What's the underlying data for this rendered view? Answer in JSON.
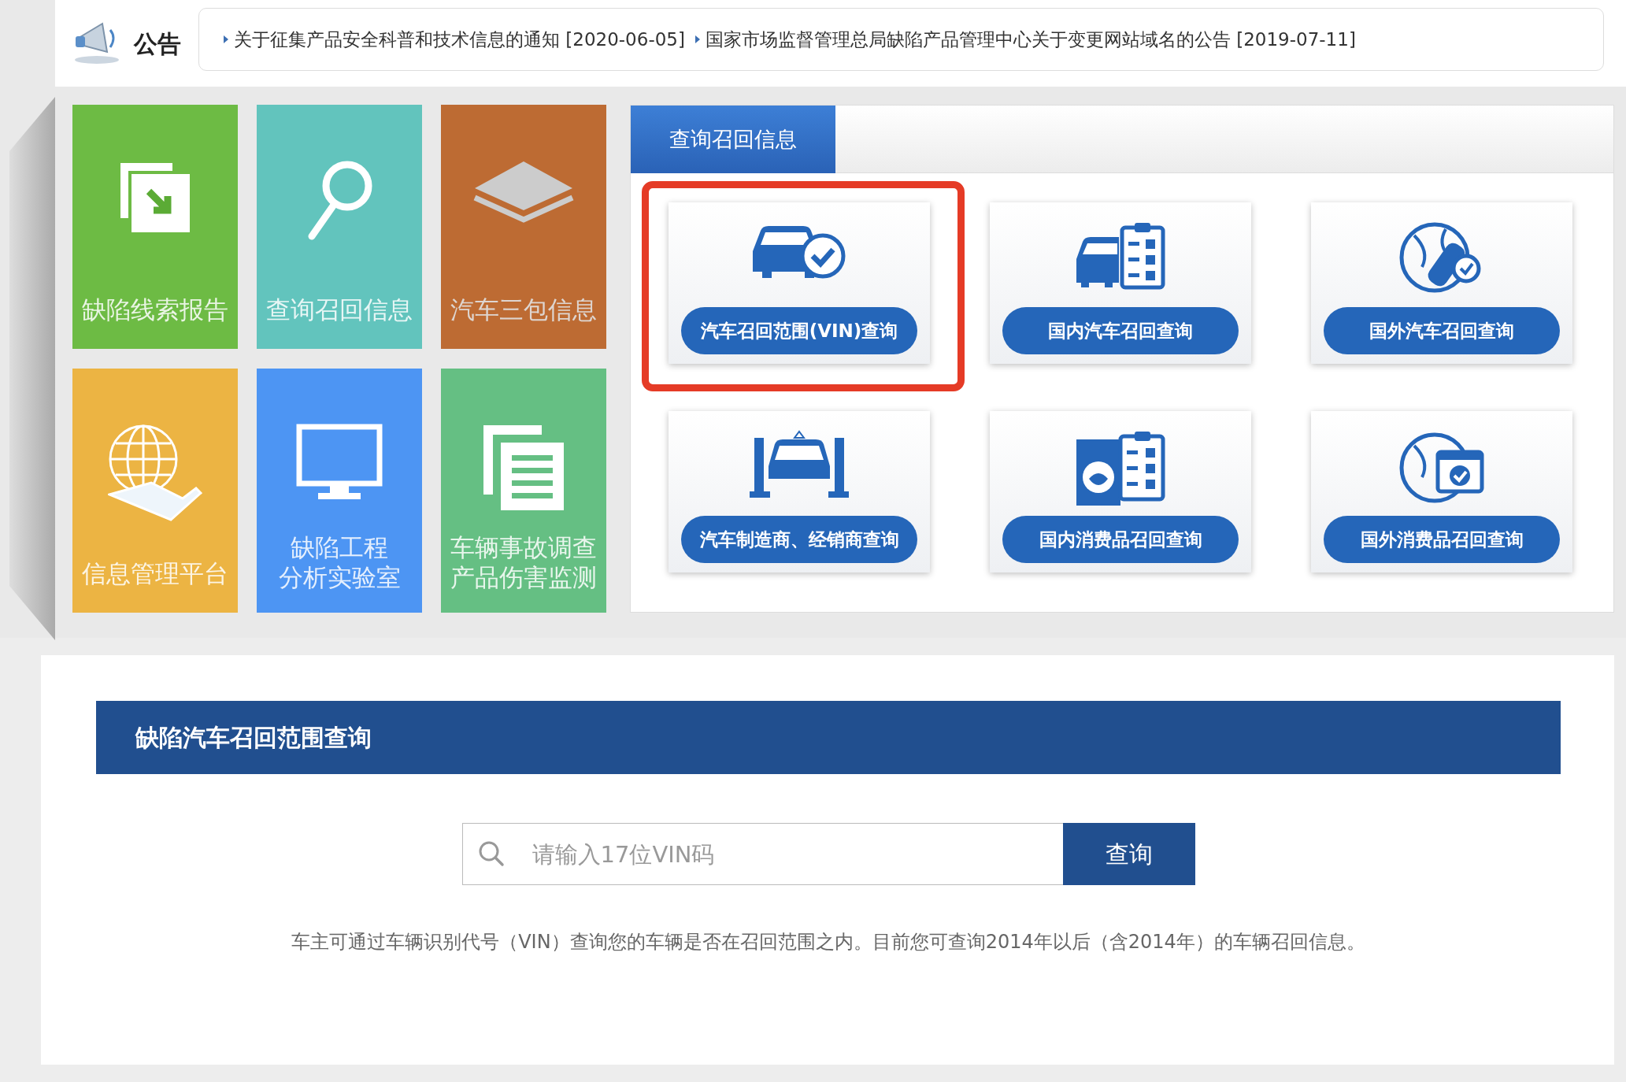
{
  "announcement": {
    "label": "公告",
    "notices": [
      {
        "text": "关于征集产品安全科普和技术信息的通知",
        "date": "[2020-06-05]"
      },
      {
        "text": "国家市场监督管理总局缺陷产品管理中心关于变更网站域名的公告",
        "date": "[2019-07-11]"
      }
    ]
  },
  "tiles": [
    {
      "kind": "report",
      "lines": [
        "缺陷线索报告"
      ],
      "color": "#6dbb44"
    },
    {
      "kind": "search",
      "lines": [
        "查询召回信息"
      ],
      "color": "#62c4bd"
    },
    {
      "kind": "layers",
      "lines": [
        "汽车三包信息"
      ],
      "color": "#bd6b33"
    },
    {
      "kind": "globe",
      "lines": [
        "信息管理平台"
      ],
      "color": "#ecb443"
    },
    {
      "kind": "monitor",
      "lines": [
        "缺陷工程",
        "分析实验室"
      ],
      "color": "#4d95f3"
    },
    {
      "kind": "documents",
      "lines": [
        "车辆事故调查",
        "产品伤害监测"
      ],
      "color": "#65bf83"
    }
  ],
  "recall_panel": {
    "tab": {
      "label": "查询召回信息",
      "selected": true
    },
    "cards": [
      {
        "kind": "car-check",
        "label": "汽车召回范围(VIN)查询",
        "highlighted": true
      },
      {
        "kind": "car-list",
        "label": "国内汽车召回查询",
        "highlighted": false
      },
      {
        "kind": "globe-car",
        "label": "国外汽车召回查询",
        "highlighted": false
      },
      {
        "kind": "lift",
        "label": "汽车制造商、经销商查询",
        "highlighted": false
      },
      {
        "kind": "washer-list",
        "label": "国内消费品召回查询",
        "highlighted": false
      },
      {
        "kind": "globe-product",
        "label": "国外消费品召回查询",
        "highlighted": false
      }
    ]
  },
  "vin_query": {
    "title": "缺陷汽车召回范围查询",
    "search": {
      "placeholder": "请输入17位VIN码"
    },
    "button": "查询",
    "note": "车主可通过车辆识别代号（VIN）查询您的车辆是否在召回范围之内。目前您可查询2014年以后（含2014年）的车辆召回信息。"
  }
}
